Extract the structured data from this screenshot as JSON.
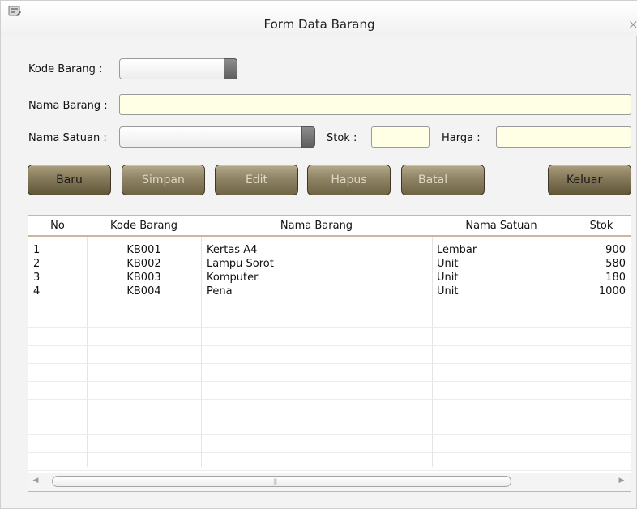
{
  "window": {
    "title": "Form Data Barang",
    "close_glyph": "×",
    "icon": "form-app-icon"
  },
  "form": {
    "kode_label": "Kode Barang :",
    "nama_label": "Nama Barang :",
    "satuan_label": "Nama Satuan :",
    "stok_label": "Stok :",
    "harga_label": "Harga :",
    "kode_value": "",
    "nama_value": "",
    "satuan_value": "",
    "stok_value": "",
    "harga_value": ""
  },
  "buttons": {
    "baru": "Baru",
    "simpan": "Simpan",
    "edit": "Edit",
    "hapus": "Hapus",
    "batal": "Batal",
    "keluar": "Keluar"
  },
  "table": {
    "headers": [
      "No",
      "Kode Barang",
      "Nama Barang",
      "Nama Satuan",
      "Stok"
    ],
    "rows": [
      [
        "1",
        "KB001",
        "Kertas A4",
        "Lembar",
        "900"
      ],
      [
        "2",
        "KB002",
        "Lampu Sorot",
        "Unit",
        "580"
      ],
      [
        "3",
        "KB003",
        "Komputer",
        "Unit",
        "180"
      ],
      [
        "4",
        "KB004",
        "Pena",
        "Unit",
        "1000"
      ]
    ]
  },
  "colors": {
    "field_bg": "#ffffe6",
    "button_bronze": "#8e8365",
    "header_underline": "#cbb79e"
  }
}
